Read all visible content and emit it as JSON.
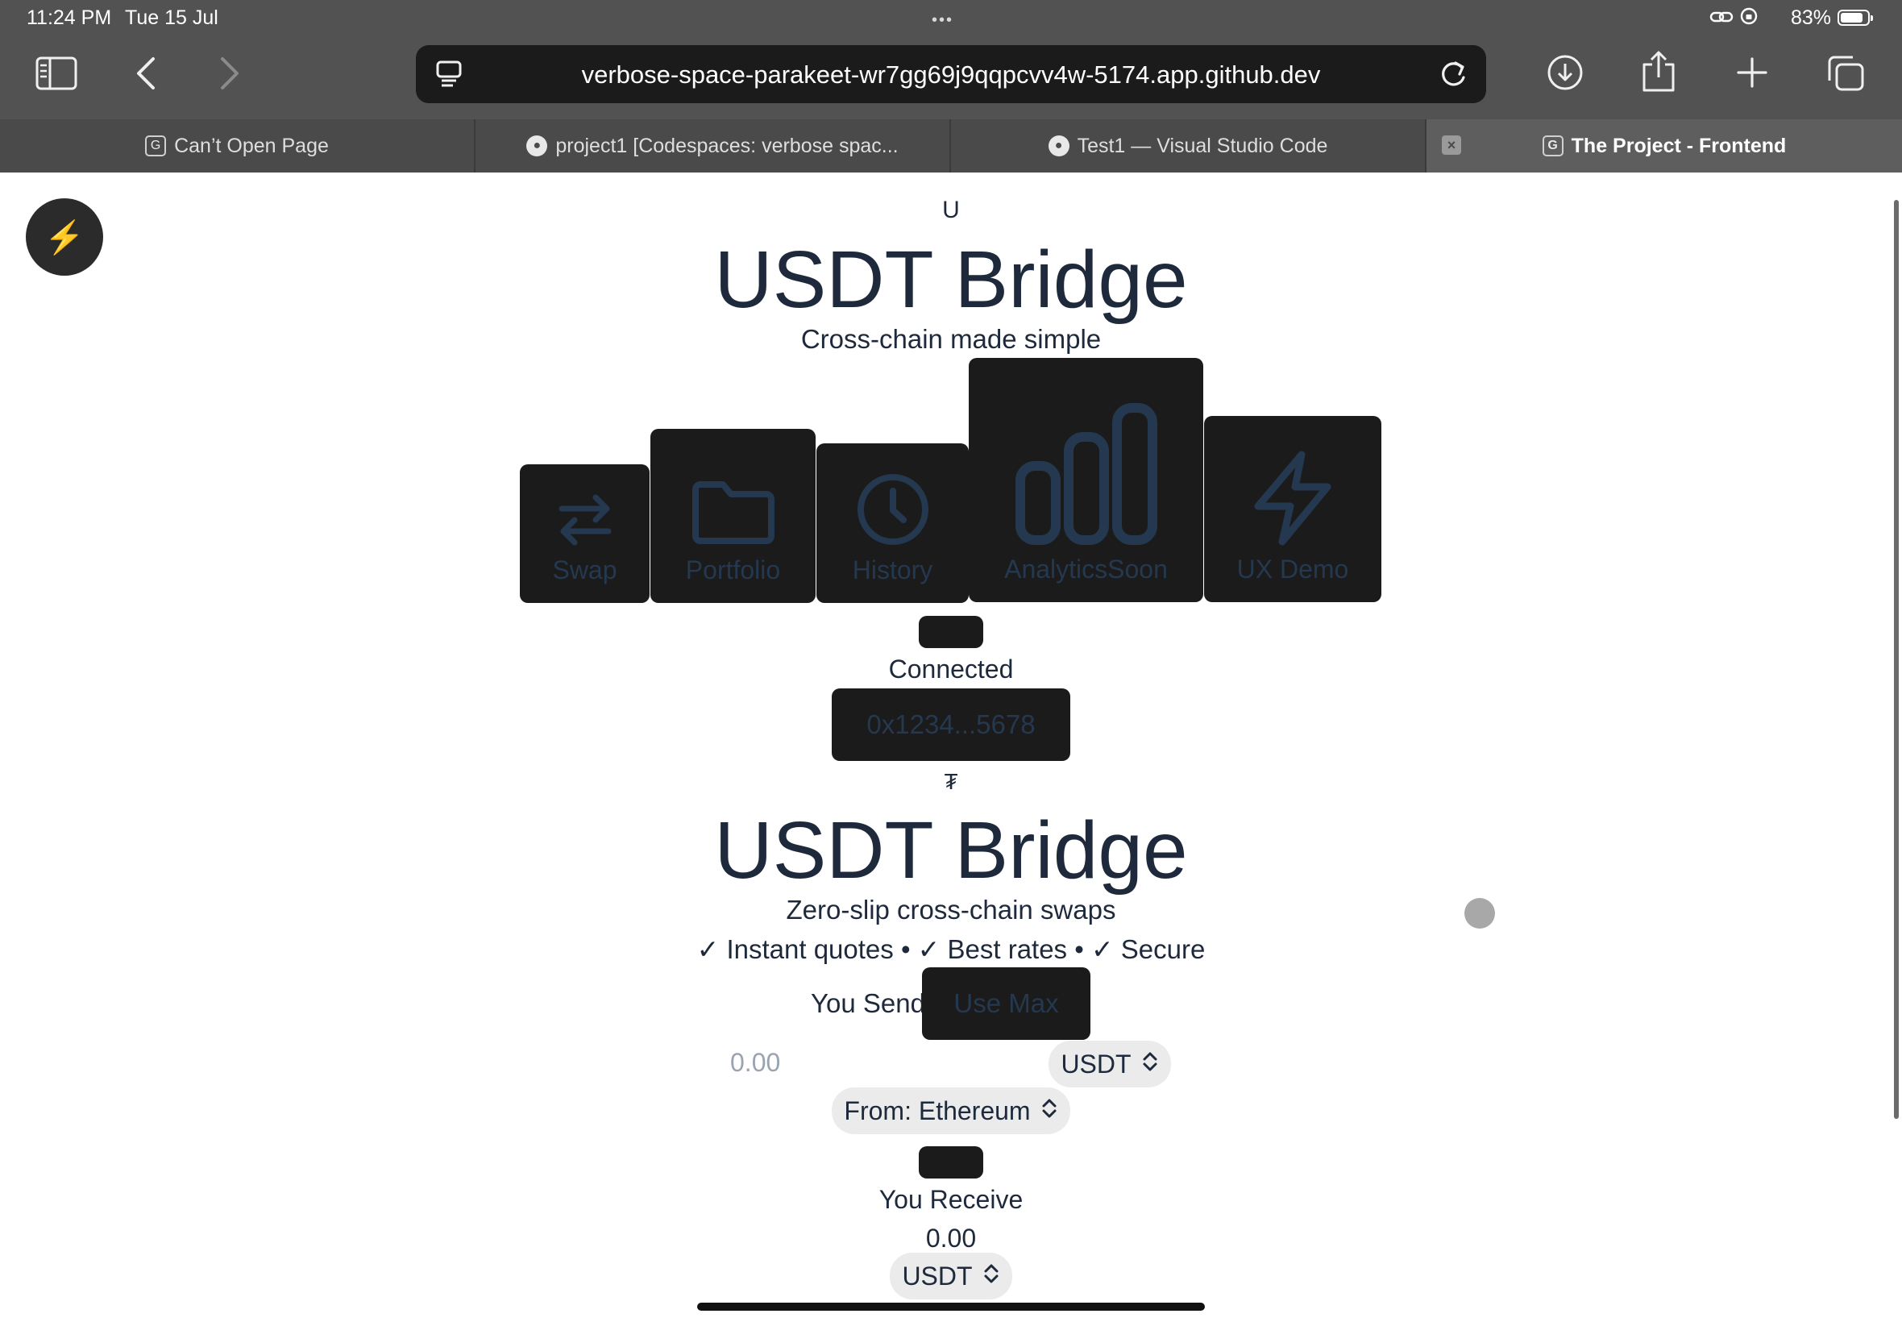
{
  "status_bar": {
    "time": "11:24 PM",
    "date": "Tue 15 Jul",
    "dots": "•••",
    "battery_percent": "83%",
    "battery_level": 0.83
  },
  "toolbar": {
    "url": "verbose-space-parakeet-wr7gg69j9qqpcvv4w-5174.app.github.dev",
    "icons": [
      "sidebar-icon",
      "back-icon",
      "forward-icon",
      "reader-icon",
      "reload-icon",
      "download-icon",
      "share-icon",
      "new-tab-icon",
      "tabs-overview-icon"
    ]
  },
  "tabs": [
    {
      "label": "Can’t Open Page",
      "favicon": "G"
    },
    {
      "label": "project1 [Codespaces: verbose spac...",
      "favicon": "github"
    },
    {
      "label": "Test1 — Visual Studio Code",
      "favicon": "github"
    },
    {
      "label": "The Project - Frontend",
      "favicon": "G",
      "active": true
    }
  ],
  "header": {
    "logo_letter": "U",
    "title": "USDT Bridge",
    "subtitle": "Cross-chain made simple"
  },
  "theme_toggle": {
    "icon": "lightning-icon",
    "glyph": "⚡"
  },
  "nav": [
    {
      "label": "Swap",
      "icon": "swap-arrows-icon"
    },
    {
      "label": "Portfolio",
      "icon": "folder-icon"
    },
    {
      "label": "History",
      "icon": "clock-icon"
    },
    {
      "label": "AnalyticsSoon",
      "icon": "bar-chart-icon"
    },
    {
      "label": "UX Demo",
      "icon": "lightning-icon"
    }
  ],
  "wallet": {
    "status": "Connected",
    "address": "0x1234...5678"
  },
  "swap_card": {
    "token_glyph": "₮",
    "title": "USDT Bridge",
    "subtitle": "Zero-slip cross-chain swaps",
    "features": "✓ Instant quotes • ✓ Best rates • ✓ Secure",
    "send_label": "You Send",
    "use_max_label": "Use Max",
    "send_placeholder": "0.00",
    "send_token": "USDT",
    "from_chain": "From: Ethereum",
    "receive_label": "You Receive",
    "receive_amount": "0.00",
    "receive_token": "USDT"
  },
  "colors": {
    "chrome_bg": "#525253",
    "tab_bar_bg": "#4a4a4b",
    "address_bg": "#1b1b1c",
    "text_navy": "#1e2a3c",
    "button_dark": "#1b1b1c",
    "button_text": "#24384f"
  }
}
